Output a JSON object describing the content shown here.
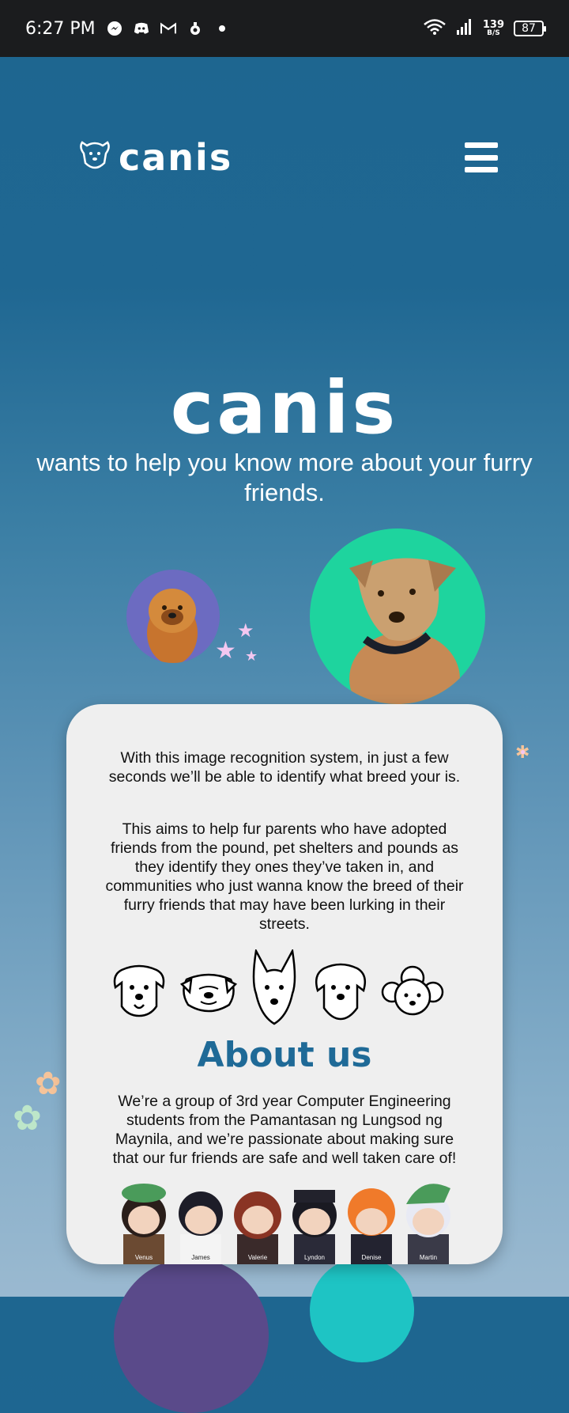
{
  "status_bar": {
    "time": "6:27 PM",
    "net_speed_value": "139",
    "net_speed_unit": "B/S",
    "battery": "87"
  },
  "header": {
    "logo_text": "canis"
  },
  "hero": {
    "title": "canis",
    "subtitle": "wants to help you know more about your furry friends."
  },
  "card": {
    "paragraph1": "With this image recognition system, in just a few seconds we’ll be able to identify what breed your is.",
    "paragraph2": "This aims to help fur parents who have adopted friends from the pound, pet shelters and pounds as they identify they ones they’ve taken in, and communities who just wanna know the breed of their furry friends that may have been lurking in their streets.",
    "about_title": "About us",
    "about_text": "We’re a group of 3rd year Computer Engineering students from the Pamantasan ng Lungsod ng Maynila, and we’re passionate about making sure that our fur friends are safe and well taken care of!",
    "team": [
      {
        "name": "Venus"
      },
      {
        "name": "James"
      },
      {
        "name": "Valerie"
      },
      {
        "name": "Lyndon"
      },
      {
        "name": "Denise"
      },
      {
        "name": "Martin"
      }
    ]
  },
  "colors": {
    "status_bar": "#1b1c1e",
    "bg_top": "#1e6690",
    "bg_bottom": "#9ab9d0",
    "card": "#efefef",
    "about_title": "#1f6a97",
    "chow_circle": "#6c6bc1",
    "stray_circle": "#1ed49e"
  }
}
